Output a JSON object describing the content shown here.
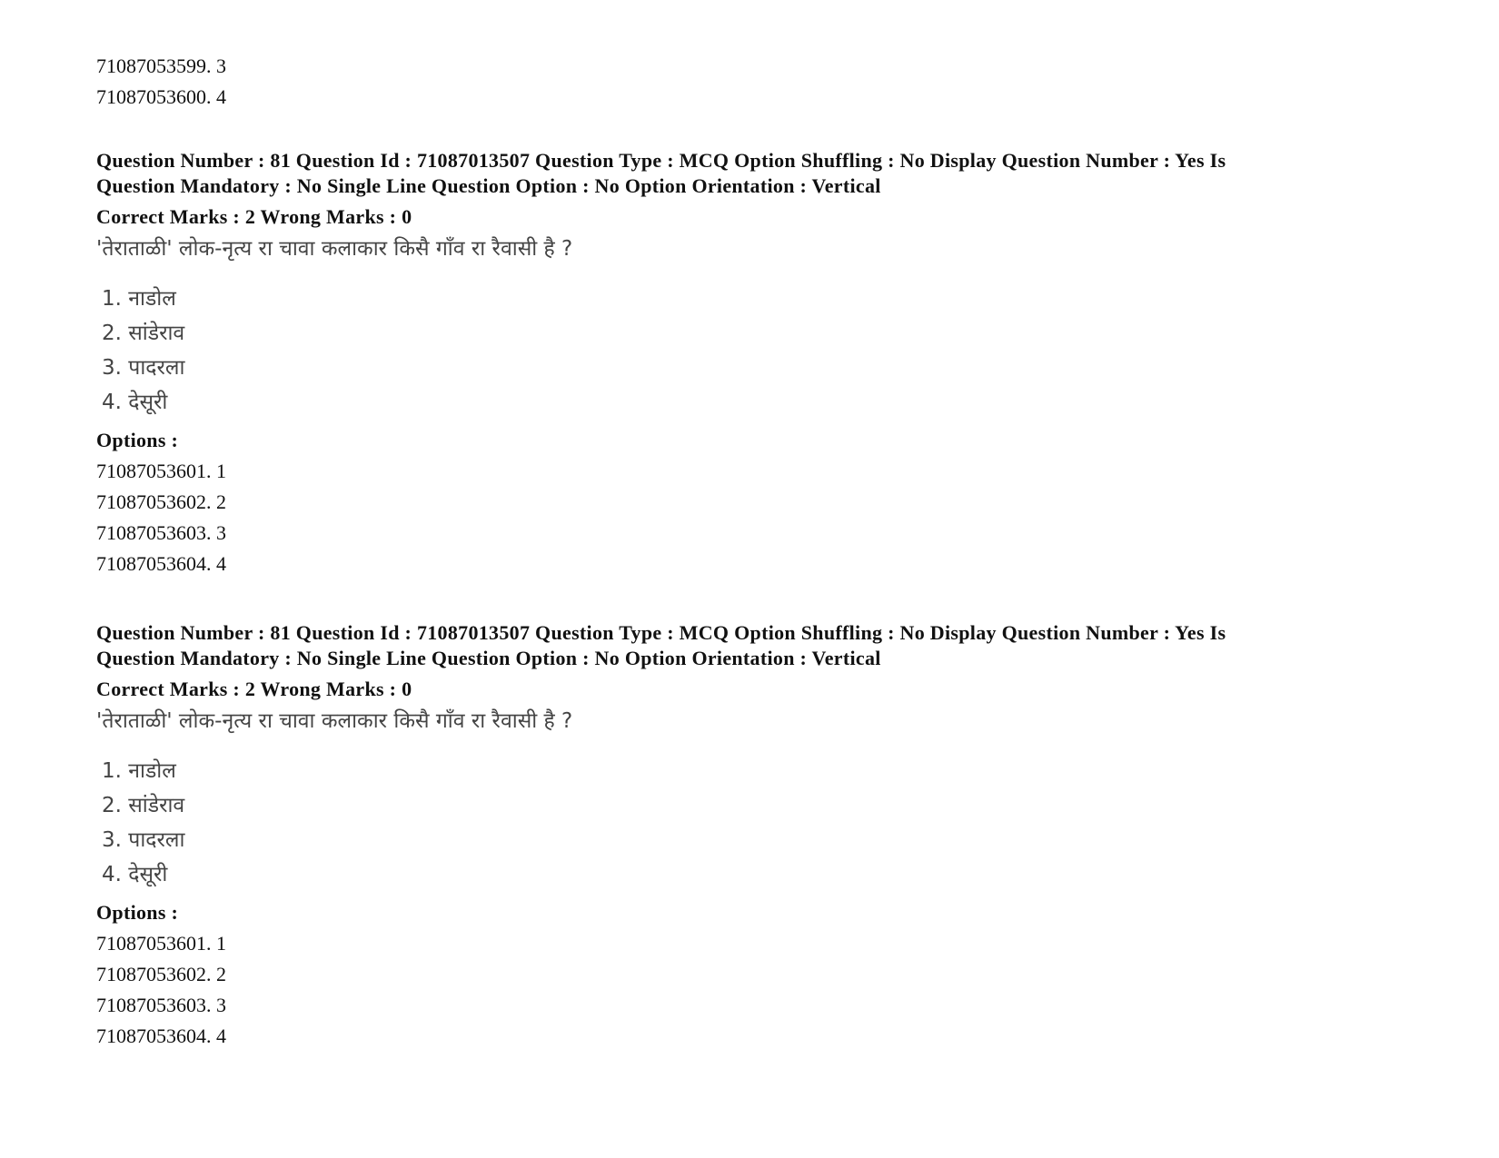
{
  "prev_options": [
    {
      "id": "71087053599",
      "value": "3"
    },
    {
      "id": "71087053600",
      "value": "4"
    }
  ],
  "questions": [
    {
      "meta_line1": "Question Number : 81 Question Id : 71087013507 Question Type : MCQ Option Shuffling : No Display Question Number : Yes Is",
      "meta_line2": "Question Mandatory : No Single Line Question Option : No Option Orientation : Vertical",
      "marks": "Correct Marks : 2 Wrong Marks : 0",
      "question_text": "'तेराताळी' लोक-नृत्य रा चावा कलाकार किसै गाँव रा रैवासी है ?",
      "choices": [
        "1. नाडोल",
        "2. सांडेराव",
        "3. पादरला",
        "4. देसूरी"
      ],
      "options_label": "Options :",
      "options": [
        {
          "id": "71087053601",
          "value": "1"
        },
        {
          "id": "71087053602",
          "value": "2"
        },
        {
          "id": "71087053603",
          "value": "3"
        },
        {
          "id": "71087053604",
          "value": "4"
        }
      ]
    },
    {
      "meta_line1": "Question Number : 81 Question Id : 71087013507 Question Type : MCQ Option Shuffling : No Display Question Number : Yes Is",
      "meta_line2": "Question Mandatory : No Single Line Question Option : No Option Orientation : Vertical",
      "marks": "Correct Marks : 2 Wrong Marks : 0",
      "question_text": "'तेराताळी' लोक-नृत्य रा चावा कलाकार किसै गाँव रा रैवासी है ?",
      "choices": [
        "1. नाडोल",
        "2. सांडेराव",
        "3. पादरला",
        "4. देसूरी"
      ],
      "options_label": "Options :",
      "options": [
        {
          "id": "71087053601",
          "value": "1"
        },
        {
          "id": "71087053602",
          "value": "2"
        },
        {
          "id": "71087053603",
          "value": "3"
        },
        {
          "id": "71087053604",
          "value": "4"
        }
      ]
    }
  ]
}
